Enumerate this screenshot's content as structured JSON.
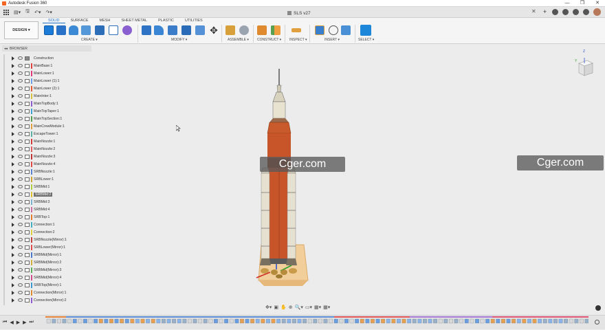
{
  "window": {
    "app_title": "Autodesk Fusion 360",
    "controls": [
      "—",
      "❐",
      "✕"
    ]
  },
  "document": {
    "tab_title": "SLS v27",
    "close_glyph": "✕"
  },
  "toolbar": {
    "workspace_label": "DESIGN ▾",
    "tabs": [
      "SOLID",
      "SURFACE",
      "MESH",
      "SHEET METAL",
      "PLASTIC",
      "UTILITIES"
    ],
    "active_tab": "SOLID",
    "groups": [
      "CREATE ▾",
      "MODIFY ▾",
      "ASSEMBLE ▾",
      "CONSTRUCT ▾",
      "INSPECT ▾",
      "INSERT ▾",
      "SELECT ▾"
    ]
  },
  "browser": {
    "header": "BROWSER",
    "items": [
      {
        "label": "Construction",
        "color": "",
        "folder": true
      },
      {
        "label": "MainBase:1",
        "color": "#e04040"
      },
      {
        "label": "MainLower:1",
        "color": "#e03a7a"
      },
      {
        "label": "MainLower (1):1",
        "color": "#6a9ee0"
      },
      {
        "label": "MainLower (2):1",
        "color": "#e35a30"
      },
      {
        "label": "MainInter:1",
        "color": "#d7c03a"
      },
      {
        "label": "MainTopBody:1",
        "color": "#8e5cd0"
      },
      {
        "label": "MainTopTaper:1",
        "color": "#3aa2d0"
      },
      {
        "label": "MainTopSection:1",
        "color": "#4e9e4e"
      },
      {
        "label": "MainCrewModule:1",
        "color": "#e0a040"
      },
      {
        "label": "EscapeTower:1",
        "color": "#5ab0a0"
      },
      {
        "label": "MainNozzle:1",
        "color": "#d33a3a"
      },
      {
        "label": "MainNozzle:2",
        "color": "#e05a5a"
      },
      {
        "label": "MainNozzle:3",
        "color": "#c03030"
      },
      {
        "label": "MainNozzle:4",
        "color": "#e04848"
      },
      {
        "label": "SRBNozzle:1",
        "color": "#5a80d0"
      },
      {
        "label": "SRBLower:1",
        "color": "#d0a030"
      },
      {
        "label": "SRBMid:1",
        "color": "#b0d040"
      },
      {
        "label": "SRBMid:2",
        "color": "#e0c030",
        "selected": true
      },
      {
        "label": "SRBMid:3",
        "color": "#7ab0d0"
      },
      {
        "label": "SRBMid:4",
        "color": "#d06aa0"
      },
      {
        "label": "SRBTop:1",
        "color": "#e07a2a"
      },
      {
        "label": "Connection:1",
        "color": "#40b0c0"
      },
      {
        "label": "Connection:2",
        "color": "#e0d040"
      },
      {
        "label": "SRBNozzle(Mirror):1",
        "color": "#c04040"
      },
      {
        "label": "SRBLower(Mirror):1",
        "color": "#e04a4a"
      },
      {
        "label": "SRBMid(Mirror):1",
        "color": "#4a7ad0"
      },
      {
        "label": "SRBMid(Mirror):2",
        "color": "#d0b03a"
      },
      {
        "label": "SRBMid(Mirror):3",
        "color": "#5ab05a"
      },
      {
        "label": "SRBMid(Mirror):4",
        "color": "#d04a8a"
      },
      {
        "label": "SRBTop(Mirror):1",
        "color": "#3a9ad0"
      },
      {
        "label": "Connection(Mirror):1",
        "color": "#e08a30"
      },
      {
        "label": "Connection(Mirror):2",
        "color": "#8a5ad0"
      }
    ]
  },
  "viewport": {
    "watermark_left": "Cger.com",
    "watermark_right": "Cger.com",
    "viewcube_axis_z": "Z",
    "viewcube_axis_y": "Y"
  },
  "timeline": {
    "controls": [
      "⏮",
      "◀",
      "▶",
      "▶",
      "⏭"
    ]
  },
  "colors": {
    "accent": "#1a6fc9",
    "rocket_core": "#c8552a",
    "rocket_booster": "#e8e2d4"
  }
}
